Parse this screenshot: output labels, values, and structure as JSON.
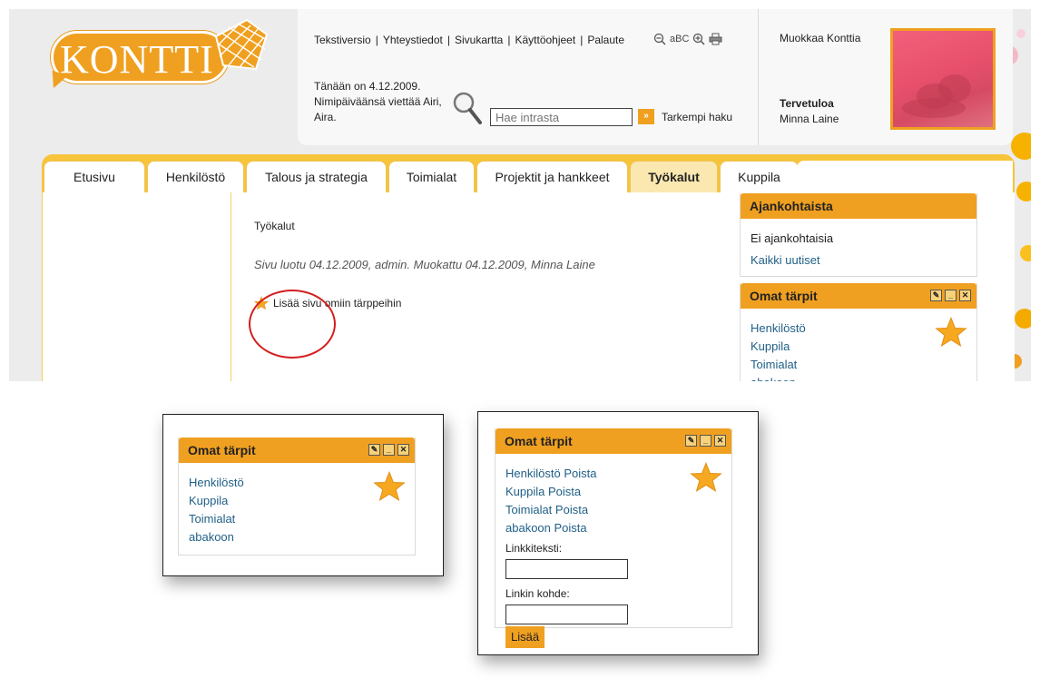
{
  "header": {
    "logo_text": "KONTTI",
    "top_links": [
      "Tekstiversio",
      "Yhteystiedot",
      "Sivukartta",
      "Käyttöohjeet",
      "Palaute"
    ],
    "tool_text_size": "aBC",
    "date_line1": "Tänään on 4.12.2009.",
    "date_line2": "Nimipäiväänsä viettää Airi,",
    "date_line3": "Aira.",
    "search_placeholder": "Hae intrasta",
    "search_go_symbol": "»",
    "advanced_search": "Tarkempi haku",
    "edit_link": "Muokkaa Konttia",
    "welcome_label": "Tervetuloa",
    "user_name": "Minna Laine"
  },
  "tabs": [
    {
      "label": "Etusivu",
      "active": false
    },
    {
      "label": "Henkilöstö",
      "active": false
    },
    {
      "label": "Talous ja strategia",
      "active": false
    },
    {
      "label": "Toimialat",
      "active": false
    },
    {
      "label": "Projektit ja hankkeet",
      "active": false
    },
    {
      "label": "Työkalut",
      "active": true
    },
    {
      "label": "Kuppila",
      "active": false
    }
  ],
  "main": {
    "heading": "Työkalut",
    "meta": "Sivu luotu 04.12.2009, admin. Muokattu 04.12.2009, Minna Laine",
    "add_favorite": "Lisää sivu omiin tärppeihin"
  },
  "news_widget": {
    "title": "Ajankohtaista",
    "empty_text": "Ei ajankohtaisia",
    "all_news_link": "Kaikki uutiset"
  },
  "favorites_widget": {
    "title": "Omat tärpit",
    "items": [
      "Henkilöstö",
      "Kuppila",
      "Toimialat",
      "abakoon"
    ],
    "remove_label": "Poista",
    "link_text_label": "Linkkiteksti:",
    "link_target_label": "Linkin kohde:",
    "add_button": "Lisää"
  },
  "icons": {
    "zoom_out": "zoom-out-icon",
    "text_size": "text-size-icon",
    "zoom_in": "zoom-in-icon",
    "print": "print-icon",
    "search": "magnifier-icon",
    "star": "star-icon"
  },
  "colors": {
    "accent_orange": "#f0a020",
    "tab_bar_yellow": "#f7c43a",
    "link_blue": "#1f5f86",
    "highlight_red": "#d41f1f"
  }
}
